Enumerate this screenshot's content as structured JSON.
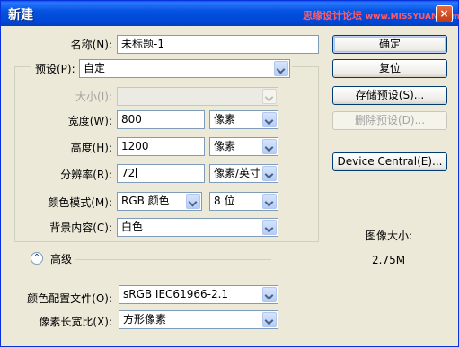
{
  "window": {
    "title": "新建",
    "watermark_main": "思缘设计论坛",
    "watermark_sub": "www.MISSYUAN.com",
    "close_symbol": "×"
  },
  "form": {
    "name": {
      "label": "名称(N):",
      "value": "未标题-1"
    },
    "preset": {
      "label": "预设(P):",
      "value": "自定"
    },
    "size": {
      "label": "大小(I):",
      "value": ""
    },
    "width": {
      "label": "宽度(W):",
      "value": "800",
      "unit": "像素"
    },
    "height": {
      "label": "高度(H):",
      "value": "1200",
      "unit": "像素"
    },
    "resolution": {
      "label": "分辨率(R):",
      "value": "72",
      "unit": "像素/英寸"
    },
    "color_mode": {
      "label": "颜色模式(M):",
      "value": "RGB 颜色",
      "depth": "8 位"
    },
    "background": {
      "label": "背景内容(C):",
      "value": "白色"
    },
    "advanced": {
      "label": "高级",
      "toggle_symbol": "⌃"
    },
    "color_profile": {
      "label": "颜色配置文件(O):",
      "value": "sRGB IEC61966-2.1"
    },
    "pixel_aspect": {
      "label": "像素长宽比(X):",
      "value": "方形像素"
    }
  },
  "buttons": {
    "ok": "确定",
    "reset": "复位",
    "save_preset": "存储预设(S)...",
    "delete_preset": "删除预设(D)...",
    "device_central": "Device Central(E)..."
  },
  "image_size": {
    "label": "图像大小:",
    "value": "2.75M"
  }
}
